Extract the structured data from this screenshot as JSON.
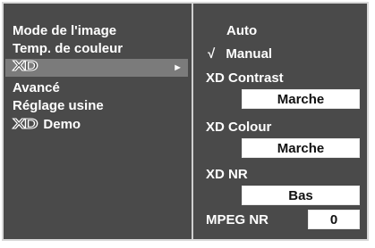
{
  "left_menu": {
    "items": [
      {
        "label": "Mode de l'image"
      },
      {
        "label": "Temp. de couleur"
      },
      {
        "label": "XD",
        "arrow": "►"
      },
      {
        "label": "Avancé"
      },
      {
        "label": "Réglage usine"
      },
      {
        "label": "XD",
        "suffix": "Demo"
      }
    ]
  },
  "right_panel": {
    "option_auto": "Auto",
    "option_manual": "Manual",
    "check_mark": "√",
    "xd_contrast": {
      "label": "XD Contrast",
      "value": "Marche"
    },
    "xd_colour": {
      "label": "XD Colour",
      "value": "Marche"
    },
    "xd_nr": {
      "label": "XD NR",
      "value": "Bas"
    },
    "mpeg_nr": {
      "label": "MPEG NR",
      "value": "0"
    }
  },
  "colors": {
    "panel": "#4a4a4a",
    "highlight": "#7b7b7b",
    "border": "#d8d8d8"
  }
}
